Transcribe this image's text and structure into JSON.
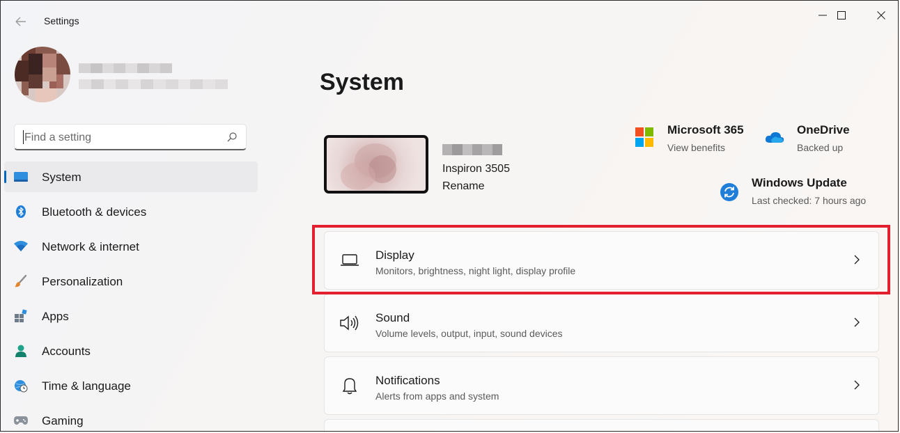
{
  "titlebar": {
    "app_title": "Settings",
    "back_icon": "back-arrow-icon",
    "minimize_icon": "minimize-icon",
    "maximize_icon": "maximize-icon",
    "close_icon": "close-icon"
  },
  "profile": {
    "avatar_icon": "avatar"
  },
  "search": {
    "placeholder": "Find a setting",
    "value": "",
    "icon": "search-icon"
  },
  "sidebar": {
    "accent_color": "#0067c0",
    "items": [
      {
        "label": "System",
        "icon": "system-icon",
        "active": true
      },
      {
        "label": "Bluetooth & devices",
        "icon": "bluetooth-icon"
      },
      {
        "label": "Network & internet",
        "icon": "wifi-icon"
      },
      {
        "label": "Personalization",
        "icon": "brush-icon"
      },
      {
        "label": "Apps",
        "icon": "apps-icon"
      },
      {
        "label": "Accounts",
        "icon": "person-icon"
      },
      {
        "label": "Time & language",
        "icon": "globe-clock-icon"
      },
      {
        "label": "Gaming",
        "icon": "gamepad-icon"
      }
    ]
  },
  "main": {
    "page_title": "System",
    "device": {
      "model": "Inspiron 3505",
      "rename": "Rename"
    },
    "services": [
      {
        "title": "Microsoft 365",
        "subtitle": "View benefits",
        "icon": "microsoft-logo-icon"
      },
      {
        "title": "OneDrive",
        "subtitle": "Backed up",
        "icon": "onedrive-cloud-icon"
      },
      {
        "title": "Windows Update",
        "subtitle": "Last checked: 7 hours ago",
        "icon": "windows-update-icon"
      }
    ],
    "cards": [
      {
        "title": "Display",
        "subtitle": "Monitors, brightness, night light, display profile",
        "icon": "laptop-icon"
      },
      {
        "title": "Sound",
        "subtitle": "Volume levels, output, input, sound devices",
        "icon": "speaker-icon"
      },
      {
        "title": "Notifications",
        "subtitle": "Alerts from apps and system",
        "icon": "bell-icon"
      }
    ],
    "highlight_color": "#e2202f"
  }
}
